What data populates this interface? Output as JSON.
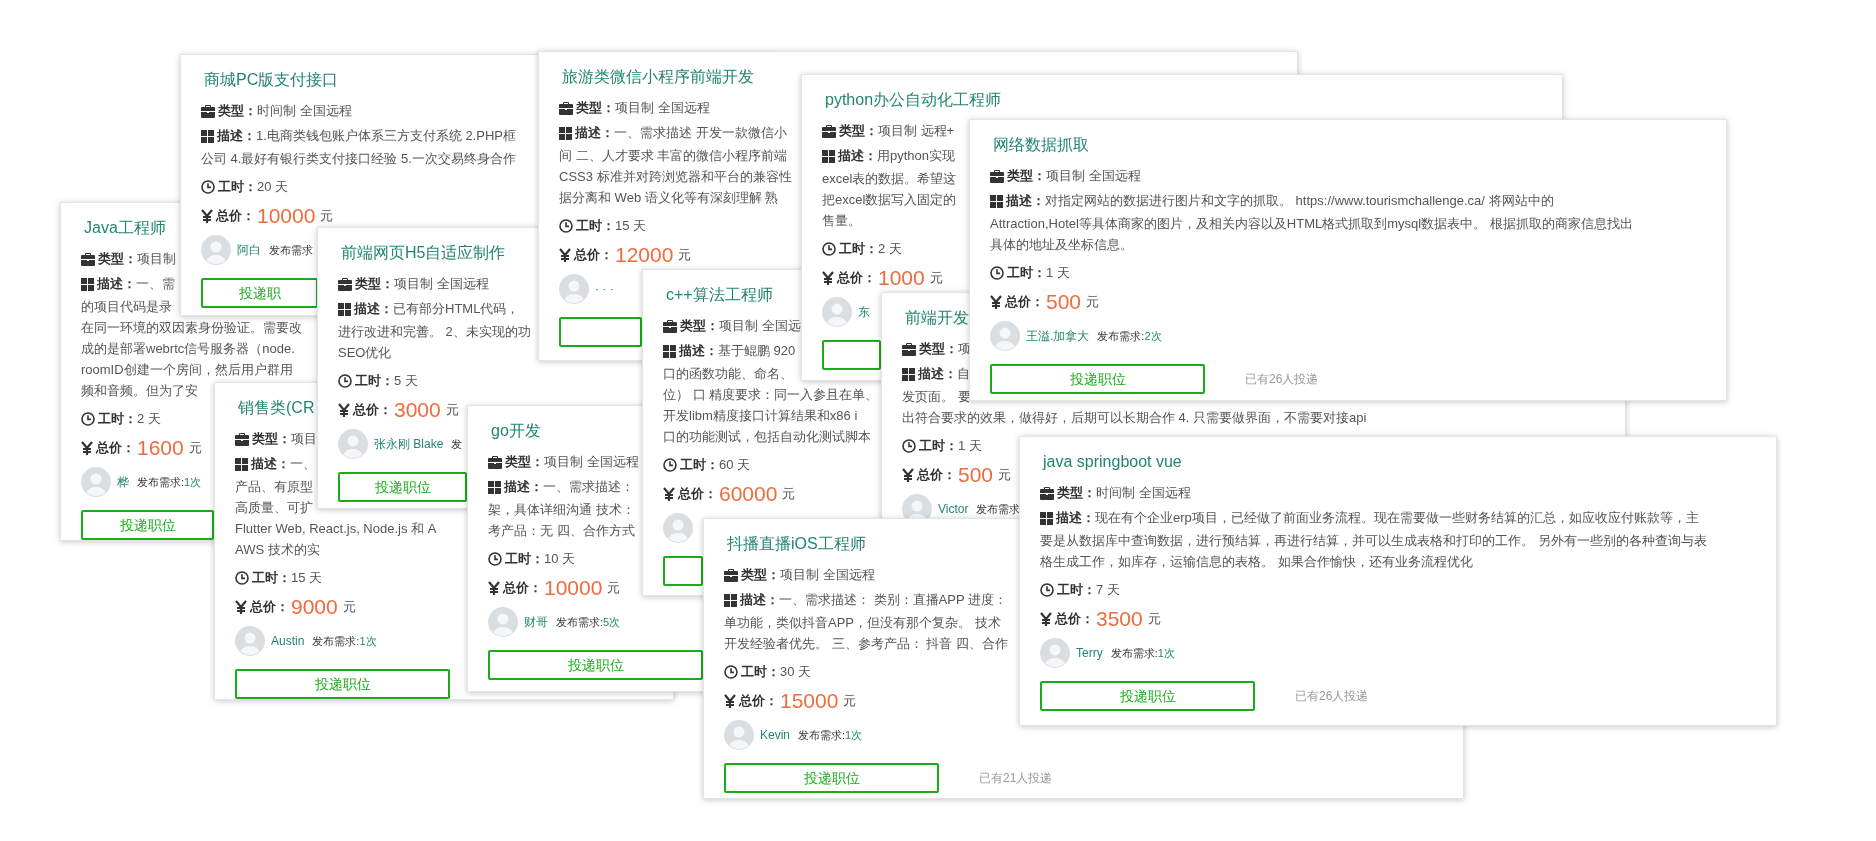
{
  "cards": [
    {
      "title": "Java工程师",
      "type_label": "类型：",
      "type": "项目制",
      "desc_label": "描述：",
      "desc": [
        "一、需",
        "的项目代码是录",
        "在同一环境的双因素身份验证。需要改",
        "成的是部署webrtc信号服务器（node.",
        "roomID创建一个房间，然后用户群用",
        "频和音频。但为了安"
      ],
      "hours_label": "工时：",
      "hours": "2 天",
      "price_label": "总价：",
      "price": "1600",
      "unit": "元",
      "user": {
        "name": "桦",
        "posts_label": "发布需求:",
        "posts": "1次"
      },
      "button": "投递职位"
    },
    {
      "title": "商城PC版支付接口",
      "type_label": "类型：",
      "type": "时间制 全国远程",
      "desc_label": "描述：",
      "desc": [
        "1.电商类钱包账户体系三方支付系统 2.PHP框",
        "公司 4.最好有银行类支付接口经验 5.一次交易终身合作"
      ],
      "hours_label": "工时：",
      "hours": "20 天",
      "price_label": "总价：",
      "price": "10000",
      "unit": "元",
      "user": {
        "name": "阿白",
        "posts_label": "发布需求"
      },
      "button": "投递职"
    },
    {
      "title": "销售类(CR",
      "type_label": "类型：",
      "type": "项目",
      "desc_label": "描述：",
      "desc": [
        "一、",
        "产品、有原型",
        "高质量、可扩",
        "Flutter Web, React.js, Node.js 和 A",
        "AWS 技术的实"
      ],
      "hours_label": "工时：",
      "hours": "15 天",
      "price_label": "总价：",
      "price": "9000",
      "unit": "元",
      "user": {
        "name": "Austin",
        "posts_label": "发布需求:",
        "posts": "1次"
      },
      "button": "投递职位"
    },
    {
      "title": "前端网页H5自适应制作",
      "type_label": "类型：",
      "type": "项目制 全国远程",
      "desc_label": "描述：",
      "desc": [
        "已有部分HTML代码，",
        "进行改进和完善。 2、未实现的功",
        "SEO优化"
      ],
      "hours_label": "工时：",
      "hours": "5 天",
      "price_label": "总价：",
      "price": "3000",
      "unit": "元",
      "user": {
        "name": "张永刚 Blake",
        "posts_label": "发"
      },
      "button": "投递职位"
    },
    {
      "title": "旅游类微信小程序前端开发",
      "type_label": "类型：",
      "type": "项目制 全国远程",
      "desc_label": "描述：",
      "desc": [
        "一、需求描述 开发一款微信小",
        "间 二、人才要求 丰富的微信小程序前端",
        "CSS3 标准并对跨浏览器和平台的兼容性",
        "据分离和 Web 语义化等有深刻理解 熟"
      ],
      "hours_label": "工时：",
      "hours": "15 天",
      "price_label": "总价：",
      "price": "12000",
      "unit": "元",
      "user": {
        "name": "· · ·"
      }
    },
    {
      "title": "go开发",
      "type_label": "类型：",
      "type": "项目制 全国远程",
      "desc_label": "描述：",
      "desc": [
        "一、需求描述：",
        "架，具体详细沟通 技术：",
        "考产品：无 四、合作方式"
      ],
      "hours_label": "工时：",
      "hours": "10 天",
      "price_label": "总价：",
      "price": "10000",
      "unit": "元",
      "user": {
        "name": "财哥",
        "posts_label": "发布需求:",
        "posts": "5次"
      },
      "button": "投递职位"
    },
    {
      "title": "c++算法工程师",
      "type_label": "类型：",
      "type": "项目制 全国远",
      "desc_label": "描述：",
      "desc": [
        "基于鲲鹏 920",
        "口的函数功能、命名、",
        "位） 口 精度要求：同一入参且在单、",
        "开发libm精度接口计算结果和x86 i",
        "口的功能测试，包括自动化测试脚本"
      ],
      "hours_label": "工时：",
      "hours": "60 天",
      "price_label": "总价：",
      "price": "60000",
      "unit": "元"
    },
    {
      "title": "python办公自动化工程师",
      "type_label": "类型：",
      "type": "项目制 远程+",
      "desc_label": "描述：",
      "desc": [
        "用python实现",
        "excel表的数据。希望这",
        "把excel数据写入固定的",
        "售量。"
      ],
      "hours_label": "工时：",
      "hours": "2 天",
      "price_label": "总价：",
      "price": "1000",
      "unit": "元",
      "user": {
        "name": "东"
      }
    },
    {
      "title": "前端开发",
      "type_label": "类型：",
      "type": "项",
      "desc_label": "描述：",
      "desc": [
        "自",
        "发页面。 要",
        "出符合要求的效果，做得好，后期可以长期合作 4. 只需要做界面，不需要对接api"
      ],
      "hours_label": "工时：",
      "hours": "1 天",
      "price_label": "总价：",
      "price": "500",
      "unit": "元",
      "user": {
        "name": "Victor",
        "posts_label": "发布需求"
      }
    },
    {
      "title": "网络数据抓取",
      "type_label": "类型：",
      "type": "项目制 全国远程",
      "desc_label": "描述：",
      "desc": [
        "对指定网站的数据进行图片和文字的抓取。 https://www.tourismchallenge.ca/ 将网站中的",
        "Attraction,Hotel等具体商家的图片，及相关内容以及HTML格式抓取到mysql数据表中。 根据抓取的商家信息找出",
        "具体的地址及坐标信息。"
      ],
      "hours_label": "工时：",
      "hours": "1 天",
      "price_label": "总价：",
      "price": "500",
      "unit": "元",
      "user": {
        "name": "王溢.加拿大",
        "posts_label": "发布需求:",
        "posts": "2次"
      },
      "button": "投递职位",
      "applied": "已有26人投递"
    },
    {
      "title": "抖播直播iOS工程师",
      "type_label": "类型：",
      "type": "项目制 全国远程",
      "desc_label": "描述：",
      "desc": [
        "一、需求描述：  类别：直播APP 进度：",
        "单功能，类似抖音APP，但没有那个复杂。 技术",
        "开发经验者优先。 三、参考产品： 抖音 四、合作"
      ],
      "hours_label": "工时：",
      "hours": "30 天",
      "price_label": "总价：",
      "price": "15000",
      "unit": "元",
      "user": {
        "name": "Kevin",
        "posts_label": "发布需求:",
        "posts": "1次"
      },
      "button": "投递职位",
      "applied": "已有21人投递"
    },
    {
      "title": "java springboot vue",
      "type_label": "类型：",
      "type": "时间制 全国远程",
      "desc_label": "描述：",
      "desc": [
        "现在有个企业erp项目，已经做了前面业务流程。现在需要做一些财务结算的汇总，如应收应付账款等，主",
        "要是从数据库中查询数据，进行预结算，再进行结算，并可以生成表格和打印的工作。 另外有一些别的各种查询与表",
        "格生成工作，如库存，运输信息的表格。 如果合作愉快，还有业务流程优化"
      ],
      "hours_label": "工时：",
      "hours": "7 天",
      "price_label": "总价：",
      "price": "3500",
      "unit": "元",
      "user": {
        "name": "Terry",
        "posts_label": "发布需求:",
        "posts": "1次"
      },
      "button": "投递职位",
      "applied": "已有26人投递"
    }
  ]
}
